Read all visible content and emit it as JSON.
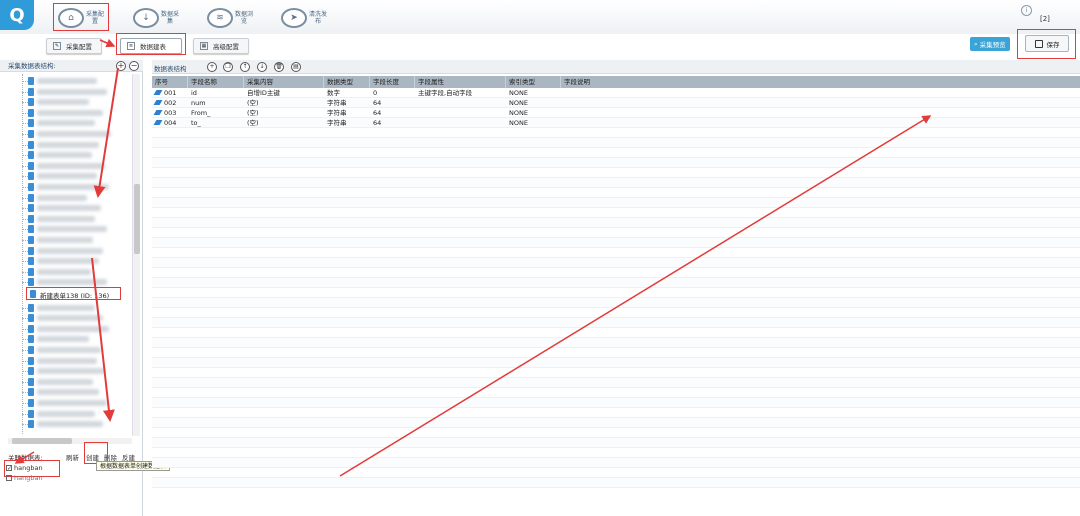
{
  "nav": {
    "items": [
      {
        "label": "采集配置",
        "icon": "home-icon"
      },
      {
        "label": "数据采集",
        "icon": "download-icon"
      },
      {
        "label": "数据浏览",
        "icon": "layers-icon"
      },
      {
        "label": "清洗发布",
        "icon": "send-icon"
      }
    ],
    "right_count": "[2]"
  },
  "subtabs": [
    {
      "label": "采集配置"
    },
    {
      "label": "数据建表"
    },
    {
      "label": "高级配置"
    }
  ],
  "actions": {
    "preview_label": "采集预览",
    "save_label": "保存"
  },
  "left": {
    "title": "采集数据表结构:",
    "selected_item": "新建表单138 (ID: 136)",
    "related_label": "关联数据表:",
    "related_actions": [
      "刷新",
      "创建",
      "删除",
      "反建"
    ],
    "tooltip": "根据数据表单创建数据表",
    "related_items": [
      {
        "name": "hangban",
        "checked": true
      },
      {
        "name": "hangban",
        "checked": false
      }
    ]
  },
  "right": {
    "title": "数据表结构",
    "columns": [
      "序号",
      "字段名称",
      "采集内容",
      "数据类型",
      "字段长度",
      "字段属性",
      "索引类型",
      "字段说明"
    ],
    "rows": [
      [
        "001",
        "id",
        "自增ID主键",
        "数字",
        "0",
        "主键字段,自动字段",
        "NONE",
        ""
      ],
      [
        "002",
        "num",
        "(空)",
        "字符串",
        "64",
        "",
        "NONE",
        ""
      ],
      [
        "003",
        "From_",
        "(空)",
        "字符串",
        "64",
        "",
        "NONE",
        ""
      ],
      [
        "004",
        "to_",
        "(空)",
        "字符串",
        "64",
        "",
        "NONE",
        ""
      ]
    ]
  },
  "colors": {
    "accent": "#3aa3d8",
    "highlight": "#e23b3b",
    "header": "#aab6c2"
  }
}
